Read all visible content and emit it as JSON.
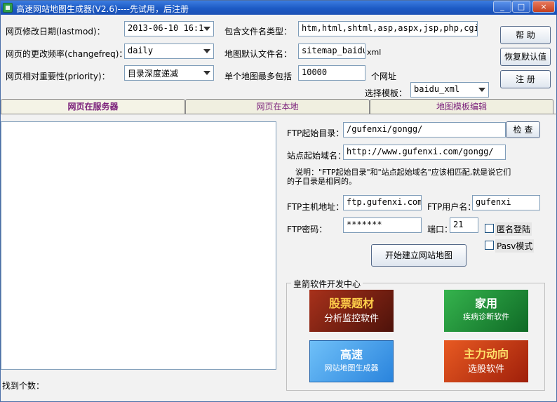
{
  "window": {
    "title": "高速网站地图生成器(V2.6)----先试用，后注册",
    "minimize": "_",
    "maximize": "□",
    "close": "×"
  },
  "settings": {
    "lastmod_label": "网页修改日期(lastmod)：",
    "lastmod_value": "2013-06-10 16:1",
    "changefreq_label": "网页的更改频率(changefreq)：",
    "changefreq_value": "daily",
    "priority_label": "网页相对重要性(priority)：",
    "priority_value": "目录深度递减",
    "filetypes_label": "包含文件名类型：",
    "filetypes_value": "htm,html,shtml,asp,aspx,jsp,php,cgi",
    "default_file_label": "地图默认文件名：",
    "default_file_value": "sitemap_baidu",
    "default_file_ext": "xml",
    "max_label": "单个地图最多包括",
    "max_value": "10000",
    "max_unit": "个网址",
    "template_label": "选择模板：",
    "template_value": "baidu_xml"
  },
  "buttons": {
    "help": "帮  助",
    "restore_default": "恢复默认值",
    "register": "注  册",
    "check": "检 查",
    "start_build": "开始建立网站地图"
  },
  "tabs": [
    {
      "label": "网页在服务器"
    },
    {
      "label": "网页在本地"
    },
    {
      "label": "地图模板编辑"
    }
  ],
  "ftp": {
    "start_dir_label": "FTP起始目录：",
    "start_dir_value": "/gufenxi/gongg/",
    "domain_label": "站点起始域名：",
    "domain_value": "http://www.gufenxi.com/gongg/",
    "note_line1": "说明：\"FTP起始目录\"和\"站点起始域名\"应该相匹配,就是说它们",
    "note_line2": "的子目录是相同的。",
    "host_label": "FTP主机地址：",
    "host_value": "ftp.gufenxi.com",
    "user_label": "FTP用户名：",
    "user_value": "gufenxi",
    "password_label": "FTP密码：",
    "password_value": "*******",
    "port_label": "端口：",
    "port_value": "21",
    "anonymous_label": "匿名登陆",
    "pasv_label": "Pasv模式"
  },
  "found_label": "找到个数：",
  "promo": {
    "group_title": "皇箭软件开发中心",
    "tiles": [
      {
        "line1": "股票题材",
        "line2": "分析监控软件",
        "color": "#7a1e12"
      },
      {
        "line1": "家用",
        "line2": "疾病诊断软件",
        "color": "#1f8a3a"
      },
      {
        "line1": "高速",
        "line2": "网站地图生成器",
        "color": "#3d9be8"
      },
      {
        "line1": "主力动向",
        "line2": "选股软件",
        "color": "#c93414"
      }
    ]
  }
}
